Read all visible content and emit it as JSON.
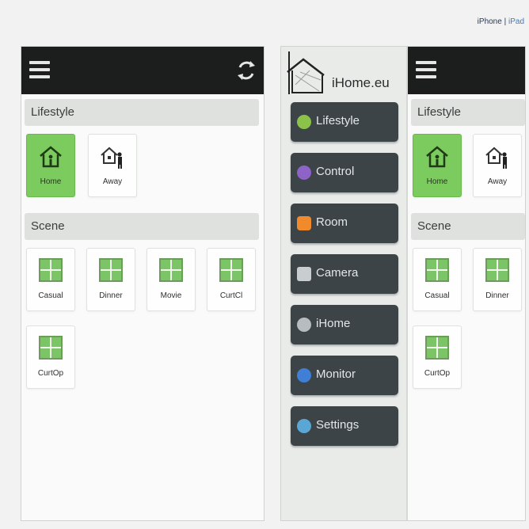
{
  "top_note": {
    "iphone": "iPhone",
    "sep": "|",
    "ipad": "iPad"
  },
  "lifestyle_label": "Lifestyle",
  "scene_label": "Scene",
  "lifestyle_items": [
    "Home",
    "Away"
  ],
  "scene_items": [
    "Casual",
    "Dinner",
    "Movie",
    "CurtCl",
    "CurtOp"
  ],
  "right_scene_items": [
    "Casual",
    "Dinner",
    "CurtOp"
  ],
  "logo_text": "iHome.eu",
  "menu": [
    {
      "label": "Lifestyle",
      "icon": "lifestyle-icon",
      "color": "#8bc34a"
    },
    {
      "label": "Control",
      "icon": "control-icon",
      "color": "#8e63c8"
    },
    {
      "label": "Room",
      "icon": "room-icon",
      "color": "#f08a2b"
    },
    {
      "label": "Camera",
      "icon": "camera-icon",
      "color": "#c9cdd0"
    },
    {
      "label": "iHome",
      "icon": "ihome-icon",
      "color": "#b7bcc0"
    },
    {
      "label": "Monitor",
      "icon": "monitor-icon",
      "color": "#3f7fd6"
    },
    {
      "label": "Settings",
      "icon": "settings-icon",
      "color": "#5aa7d6"
    }
  ],
  "colors": {
    "active_tile": "#7ccb5e",
    "topbar": "#1c1d1d",
    "menu_button": "#3c4447"
  }
}
